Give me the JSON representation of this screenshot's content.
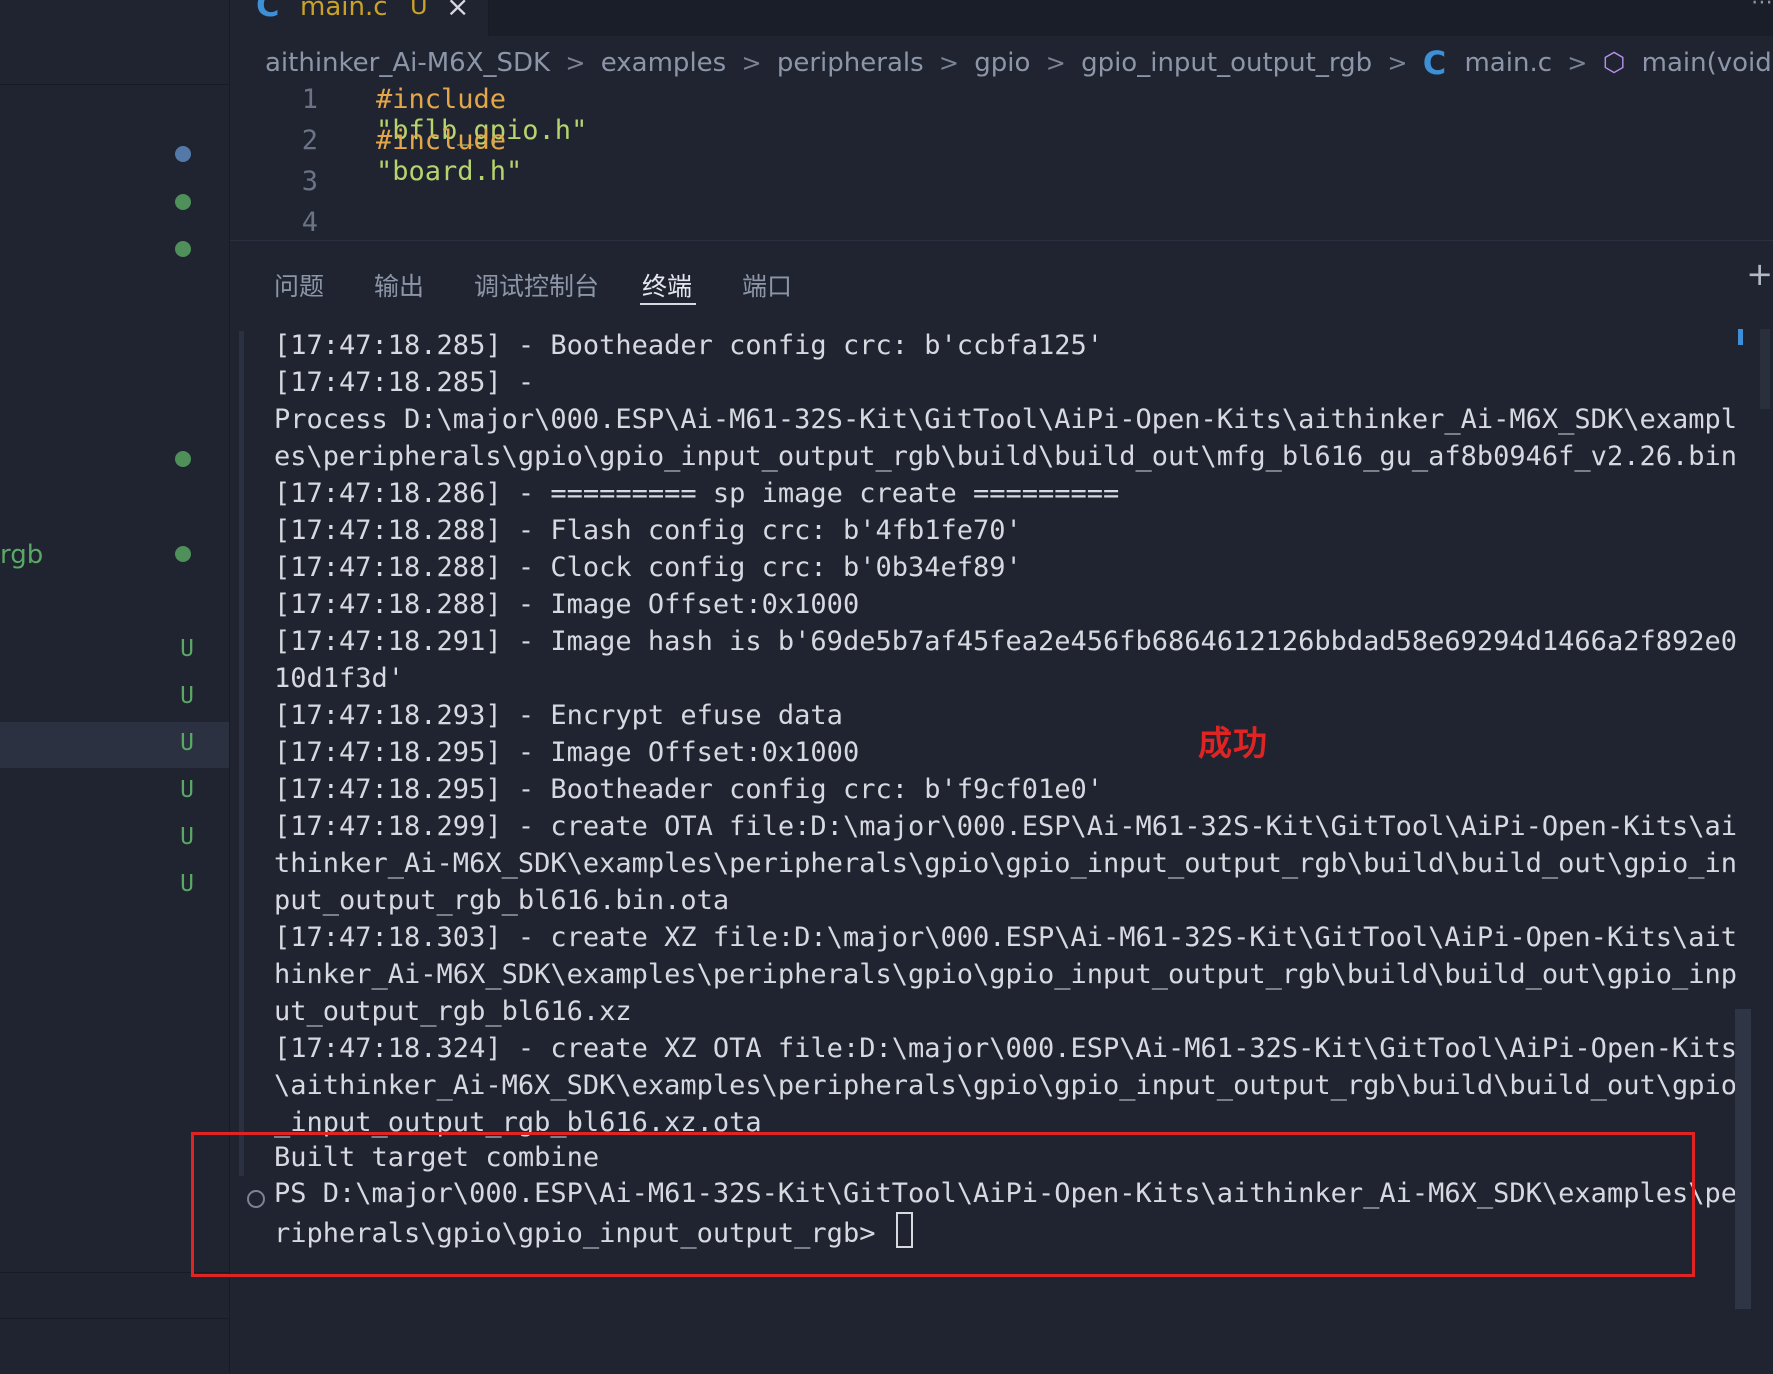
{
  "tab": {
    "filename": "main.c",
    "status": "U",
    "close": "×"
  },
  "breadcrumb": {
    "items": [
      "aithinker_Ai-M6X_SDK",
      "examples",
      "peripherals",
      "gpio",
      "gpio_input_output_rgb"
    ],
    "file": "main.c",
    "symbol": "main(void)"
  },
  "code": {
    "lines": [
      {
        "num": "1",
        "keyword": "#include",
        "string": "\"bflb_gpio.h\""
      },
      {
        "num": "2",
        "keyword": "#include",
        "string": "\"board.h\""
      },
      {
        "num": "3",
        "keyword": "",
        "string": ""
      },
      {
        "num": "4",
        "keyword": "",
        "string": ""
      }
    ]
  },
  "sidebar": {
    "fragment": "rgb",
    "badges": [
      "U",
      "U",
      "U",
      "U",
      "U",
      "U"
    ]
  },
  "panel": {
    "tabs": [
      "问题",
      "输出",
      "调试控制台",
      "终端",
      "端口"
    ],
    "active_tab": "终端"
  },
  "terminal": {
    "output": "[17:47:18.285] - Bootheader config crc: b'ccbfa125'\n[17:47:18.285] -\nProcess D:\\major\\000.ESP\\Ai-M61-32S-Kit\\GitTool\\AiPi-Open-Kits\\aithinker_Ai-M6X_SDK\\exampl\nes\\peripherals\\gpio\\gpio_input_output_rgb\\build\\build_out\\mfg_bl616_gu_af8b0946f_v2.26.bin\n[17:47:18.286] - ========= sp image create =========\n[17:47:18.288] - Flash config crc: b'4fb1fe70'\n[17:47:18.288] - Clock config crc: b'0b34ef89'\n[17:47:18.288] - Image Offset:0x1000\n[17:47:18.291] - Image hash is b'69de5b7af45fea2e456fb6864612126bbdad58e69294d1466a2f892e0\n10d1f3d'\n[17:47:18.293] - Encrypt efuse data\n[17:47:18.295] - Image Offset:0x1000\n[17:47:18.295] - Bootheader config crc: b'f9cf01e0'\n[17:47:18.299] - create OTA file:D:\\major\\000.ESP\\Ai-M61-32S-Kit\\GitTool\\AiPi-Open-Kits\\ai\nthinker_Ai-M6X_SDK\\examples\\peripherals\\gpio\\gpio_input_output_rgb\\build\\build_out\\gpio_in\nput_output_rgb_bl616.bin.ota\n[17:47:18.303] - create XZ file:D:\\major\\000.ESP\\Ai-M61-32S-Kit\\GitTool\\AiPi-Open-Kits\\ait\nhinker_Ai-M6X_SDK\\examples\\peripherals\\gpio\\gpio_input_output_rgb\\build\\build_out\\gpio_inp\nut_output_rgb_bl616.xz\n[17:47:18.324] - create XZ OTA file:D:\\major\\000.ESP\\Ai-M61-32S-Kit\\GitTool\\AiPi-Open-Kits\n\\aithinker_Ai-M6X_SDK\\examples\\peripherals\\gpio\\gpio_input_output_rgb\\build\\build_out\\gpio\n_input_output_rgb_bl616.xz.ota",
    "built": "Built target combine",
    "prompt": "PS D:\\major\\000.ESP\\Ai-M61-32S-Kit\\GitTool\\AiPi-Open-Kits\\aithinker_Ai-M6X_SDK\\examples\\pe\nripherals\\gpio\\gpio_input_output_rgb> "
  },
  "annotation": {
    "label": "成功"
  },
  "colors": {
    "background": "#1f2430",
    "accent_blue": "#3d8fd6",
    "git_green": "#5aa865",
    "annotation_red": "#e02424",
    "keyword_orange": "#e3a74a",
    "string_green": "#b7d36e"
  },
  "icons": [
    "c-file-icon",
    "close-icon",
    "chevron-right-icon",
    "cube-icon",
    "plus-icon"
  ]
}
